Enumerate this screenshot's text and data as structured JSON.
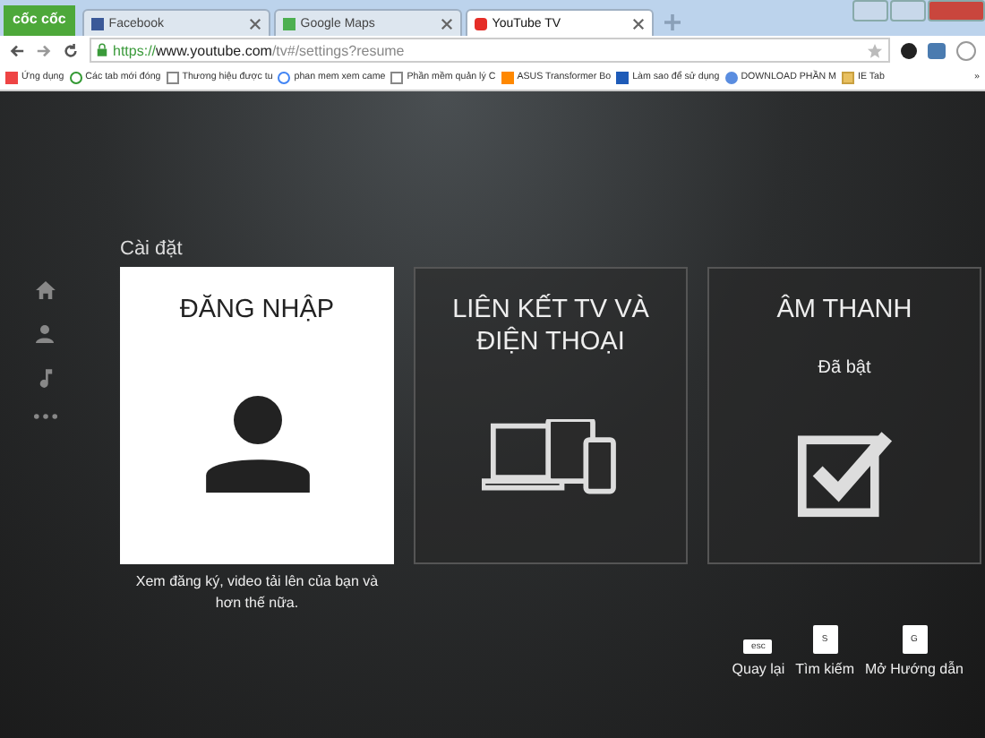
{
  "browser": {
    "brand": "cốc cốc",
    "tabs": [
      {
        "title": "Facebook",
        "kind": "facebook",
        "selected": false
      },
      {
        "title": "Google Maps",
        "kind": "maps",
        "selected": false
      },
      {
        "title": "YouTube TV",
        "kind": "youtube",
        "selected": true
      }
    ],
    "address": {
      "scheme": "https://",
      "host": "www.youtube.com",
      "path": "/tv#/settings?resume"
    },
    "bookmarks": [
      {
        "label": "Ứng dụng",
        "kind": "apps"
      },
      {
        "label": "Các tab mới đóng",
        "kind": "history"
      },
      {
        "label": "Thương hiệu được tu",
        "kind": "page"
      },
      {
        "label": "phan mem xem came",
        "kind": "google"
      },
      {
        "label": "Phần mềm quản lý C",
        "kind": "page"
      },
      {
        "label": "ASUS Transformer Bo",
        "kind": "asus"
      },
      {
        "label": "Làm sao để sử dụng",
        "kind": "blue"
      },
      {
        "label": "DOWNLOAD PHẦN M",
        "kind": "globe"
      },
      {
        "label": "IE Tab",
        "kind": "folder"
      }
    ],
    "more": "»"
  },
  "page": {
    "heading": "Cài đặt",
    "nav": [
      {
        "kind": "home"
      },
      {
        "kind": "person"
      },
      {
        "kind": "music"
      },
      {
        "kind": "more"
      }
    ],
    "cards": [
      {
        "title": "ĐĂNG NHẬP",
        "kind": "login",
        "selected": true,
        "caption": "Xem đăng ký, video tải lên của bạn và hơn thế nữa."
      },
      {
        "title": "LIÊN KẾT TV VÀ ĐIỆN THOẠI",
        "kind": "devices",
        "selected": false
      },
      {
        "title": "ÂM THANH",
        "kind": "sound",
        "selected": false,
        "status": "Đã bật",
        "checked": true
      }
    ],
    "hints": [
      {
        "key": "esc",
        "label": "Quay lại",
        "kind": "wide"
      },
      {
        "key": "S",
        "label": "Tìm kiếm",
        "kind": "square"
      },
      {
        "key": "G",
        "label": "Mở Hướng dẫn",
        "kind": "square"
      }
    ]
  }
}
